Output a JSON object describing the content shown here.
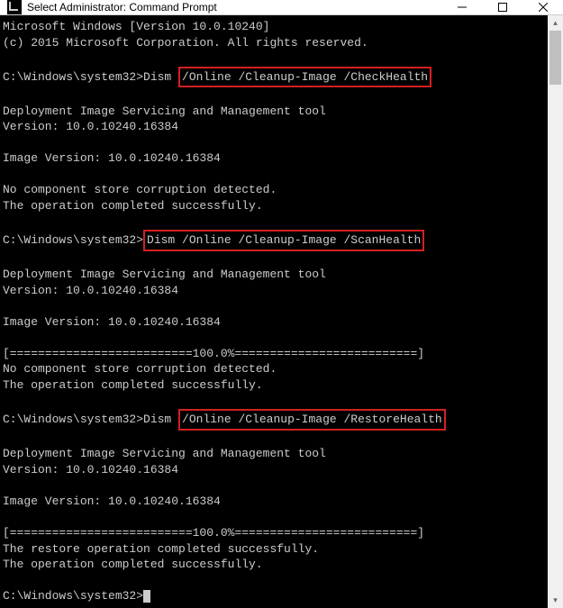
{
  "titlebar": {
    "title": "Select Administrator: Command Prompt"
  },
  "lines": {
    "l1": "Microsoft Windows [Version 10.0.10240]",
    "l2": "(c) 2015 Microsoft Corporation. All rights reserved.",
    "prompt1_pre": "C:\\Windows\\system32>Dism ",
    "cmd1": "/Online /Cleanup-Image /CheckHealth",
    "tool": "Deployment Image Servicing and Management tool",
    "ver": "Version: 10.0.10240.16384",
    "imgver": "Image Version: 10.0.10240.16384",
    "nocorrupt": "No component store corruption detected.",
    "success": "The operation completed successfully.",
    "prompt2_pre": "C:\\Windows\\system32>",
    "cmd2": "Dism /Online /Cleanup-Image /ScanHealth",
    "progress": "[==========================100.0%==========================]",
    "prompt3_pre": "C:\\Windows\\system32>Dism ",
    "cmd3": "/Online /Cleanup-Image /RestoreHealth",
    "restoresuccess": "The restore operation completed successfully.",
    "promptend": "C:\\Windows\\system32>"
  }
}
